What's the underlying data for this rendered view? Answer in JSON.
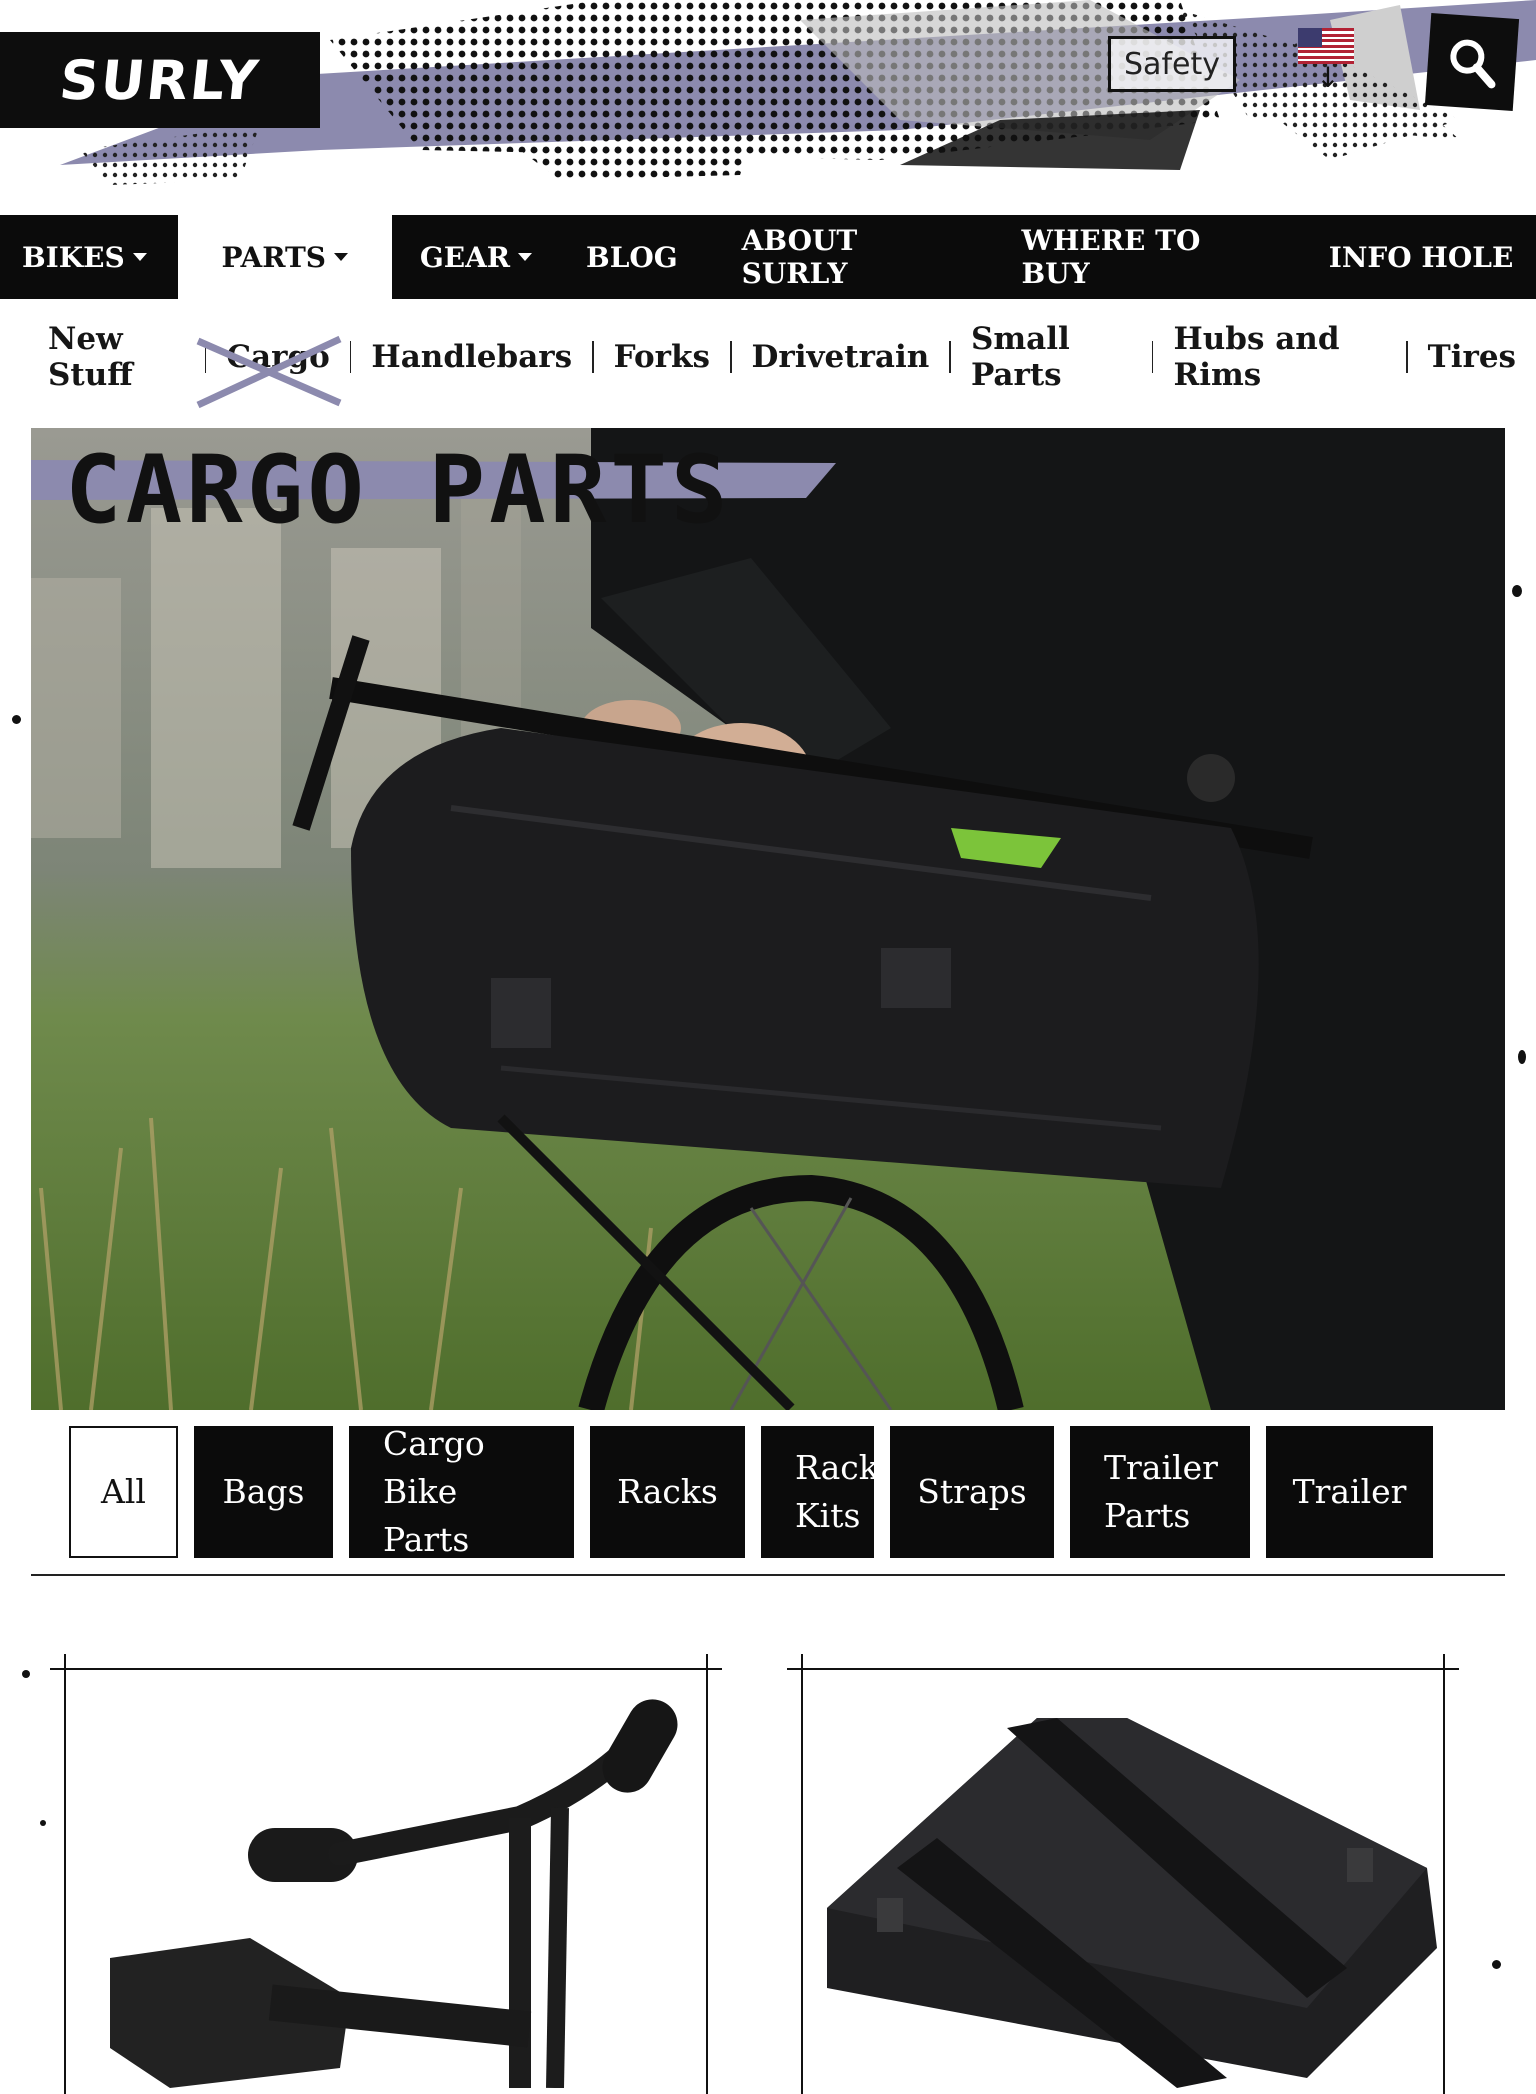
{
  "header": {
    "logo_text": "SURLY",
    "safety_label": "Safety",
    "language_flag": "us-flag-icon",
    "search_icon": "search-icon",
    "accent_color": "#8c8aae"
  },
  "main_nav": {
    "items": [
      {
        "label": "BIKES",
        "has_dropdown": true
      },
      {
        "label": "PARTS",
        "has_dropdown": true,
        "active": true
      },
      {
        "label": "GEAR",
        "has_dropdown": true
      },
      {
        "label": "BLOG"
      },
      {
        "label": "ABOUT SURLY"
      },
      {
        "label": "WHERE TO BUY"
      },
      {
        "label": "INFO HOLE"
      }
    ]
  },
  "sub_nav": {
    "items": [
      {
        "label": "New Stuff"
      },
      {
        "label": "Cargo",
        "active": true
      },
      {
        "label": "Handlebars"
      },
      {
        "label": "Forks"
      },
      {
        "label": "Drivetrain"
      },
      {
        "label": "Small Parts"
      },
      {
        "label": "Hubs and Rims"
      },
      {
        "label": "Tires"
      }
    ]
  },
  "hero": {
    "title": "CARGO PARTS"
  },
  "filters": {
    "items": [
      {
        "lines": [
          "All"
        ],
        "active": true
      },
      {
        "lines": [
          "Bags"
        ]
      },
      {
        "lines": [
          "Cargo",
          "Bike Parts"
        ]
      },
      {
        "lines": [
          "Racks"
        ]
      },
      {
        "lines": [
          "Rack",
          "Kits"
        ]
      },
      {
        "lines": [
          "Straps"
        ]
      },
      {
        "lines": [
          "Trailer",
          "Parts"
        ]
      },
      {
        "lines": [
          "Trailer"
        ]
      }
    ]
  },
  "products": [
    {
      "image": "handlebar-stoker-bar-image"
    },
    {
      "image": "black-cargo-bag-image"
    }
  ]
}
